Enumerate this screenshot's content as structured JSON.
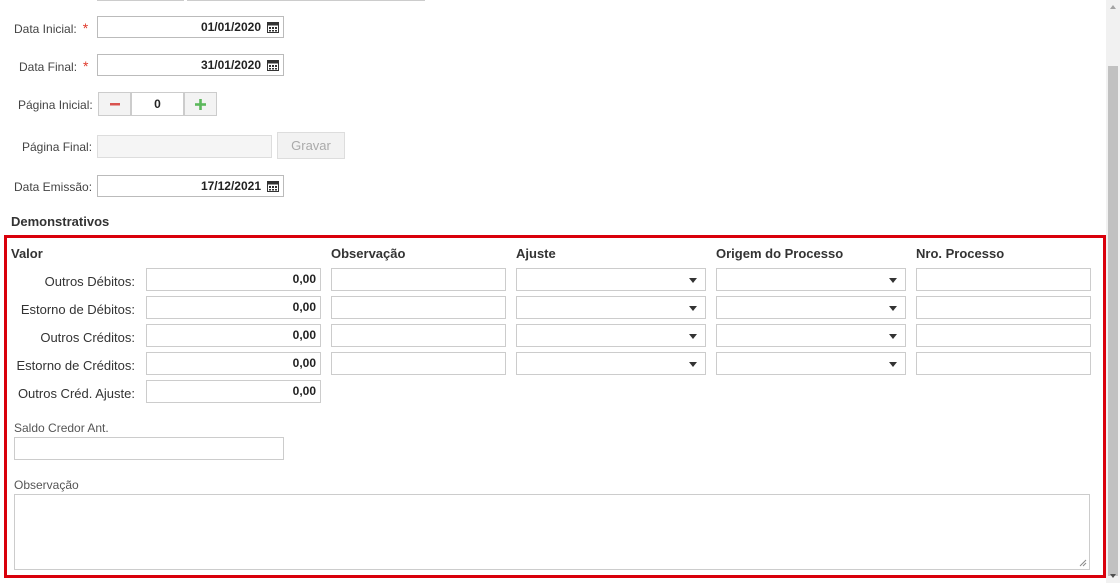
{
  "form": {
    "data_inicial": {
      "label": "Data Inicial:",
      "required": "*",
      "value": "01/01/2020"
    },
    "data_final": {
      "label": "Data Final:",
      "required": "*",
      "value": "31/01/2020"
    },
    "pagina_inicial": {
      "label": "Página Inicial:",
      "minus": "−",
      "value": "0",
      "plus": "+"
    },
    "pagina_final": {
      "label": "Página Final:",
      "value": "",
      "save_label": "Gravar"
    },
    "data_emissao": {
      "label": "Data Emissão:",
      "value": "17/12/2021"
    }
  },
  "demonstrativos": {
    "title": "Demonstrativos",
    "columns": [
      "Valor",
      "Observação",
      "Ajuste",
      "Origem do Processo",
      "Nro. Processo"
    ],
    "rows": [
      {
        "label": "Outros Débitos:",
        "value": "0,00"
      },
      {
        "label": "Estorno de Débitos:",
        "value": "0,00"
      },
      {
        "label": "Outros Créditos:",
        "value": "0,00"
      },
      {
        "label": "Estorno de Créditos:",
        "value": "0,00"
      },
      {
        "label": "Outros Créd. Ajuste:",
        "value": "0,00"
      }
    ],
    "saldo_label": "Saldo Credor Ant.",
    "saldo_value": "",
    "observacao_label": "Observação",
    "observacao_value": ""
  },
  "colors": {
    "required": "#e0392b",
    "highlight_border": "#d9000b",
    "minus": "#d9534f",
    "plus": "#5cb85c"
  },
  "icons": [
    "calendar-icon",
    "minus-icon",
    "plus-icon",
    "chevron-down-icon",
    "resize-grip-icon"
  ]
}
